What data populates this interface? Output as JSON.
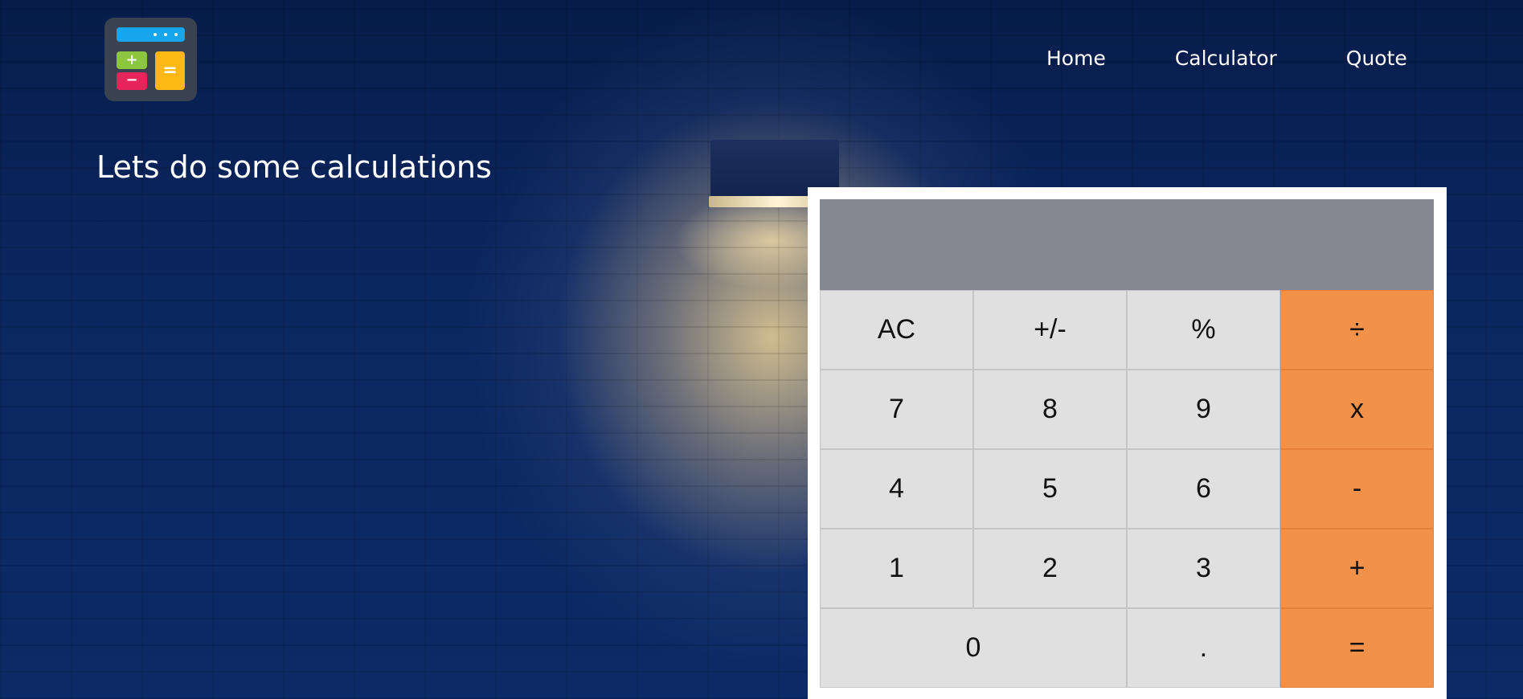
{
  "nav": {
    "items": [
      {
        "label": "Home"
      },
      {
        "label": "Calculator"
      },
      {
        "label": "Quote"
      }
    ]
  },
  "hero": {
    "title": "Lets do some calculations"
  },
  "calculator": {
    "display": "",
    "keys": {
      "ac": "AC",
      "plus_minus": "+/-",
      "percent": "%",
      "divide": "÷",
      "seven": "7",
      "eight": "8",
      "nine": "9",
      "multiply": "x",
      "four": "4",
      "five": "5",
      "six": "6",
      "subtract": "-",
      "one": "1",
      "two": "2",
      "three": "3",
      "add": "+",
      "zero": "0",
      "decimal": ".",
      "equals": "="
    },
    "colors": {
      "operator": "#f2914a",
      "key": "#e0e0e0",
      "display": "#858893"
    }
  },
  "logo": {
    "icon": "calculator-app-icon",
    "colors": {
      "screen": "#17a6ee",
      "plus": "#8cc63f",
      "minus": "#e8245c",
      "equals": "#fdb813",
      "body": "#3a4250"
    }
  }
}
